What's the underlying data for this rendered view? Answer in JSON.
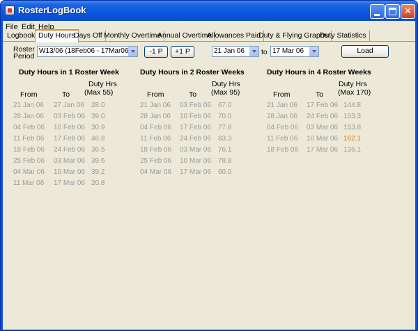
{
  "window": {
    "title": "RosterLogBook"
  },
  "menu": [
    "File",
    "Edit",
    "Help"
  ],
  "tabs": [
    "Logbook",
    "Duty Hours",
    "Days Off",
    "Monthly Overtime",
    "Annual Overtime",
    "Allowances Paid",
    "Duty & Flying Graphs",
    "Duty Statistics"
  ],
  "active_tab": "Duty Hours",
  "controls": {
    "roster_label_1": "Roster",
    "roster_label_2": "Period",
    "roster_period_value": "W13/06 (18Feb06 - 17Mar06)",
    "minus_button": "-1 P",
    "plus_button": "+1 P",
    "from_date": "21 Jan  06",
    "to_label": "to",
    "to_date": "17 Mar  06",
    "load_button": "Load"
  },
  "sections": [
    {
      "title": "Duty Hours in 1 Roster Week",
      "headers": {
        "from": "From",
        "to": "To",
        "duty_1": "Duty Hrs",
        "duty_2": "(Max 55)"
      },
      "rows": [
        [
          "21 Jan 06",
          "27 Jan 06",
          "28.0"
        ],
        [
          "28 Jan 06",
          "03 Feb 06",
          "39.0"
        ],
        [
          "04 Feb 06",
          "10 Feb 06",
          "30.9"
        ],
        [
          "11 Feb 06",
          "17 Feb 06",
          "46.8"
        ],
        [
          "18 Feb 06",
          "24 Feb 06",
          "36.5"
        ],
        [
          "25 Feb 06",
          "03 Mar 06",
          "39.6"
        ],
        [
          "04 Mar 06",
          "10 Mar 06",
          "39.2"
        ],
        [
          "11 Mar 06",
          "17 Mar 06",
          "20.8"
        ]
      ]
    },
    {
      "title": "Duty Hours in 2 Roster Weeks",
      "headers": {
        "from": "From",
        "to": "To",
        "duty_1": "Duty Hrs",
        "duty_2": "(Max 95)"
      },
      "rows": [
        [
          "21 Jan 06",
          "03 Feb 06",
          "67.0"
        ],
        [
          "28 Jan 06",
          "10 Feb 06",
          "70.0"
        ],
        [
          "04 Feb 06",
          "17 Feb 06",
          "77.8"
        ],
        [
          "11 Feb 06",
          "24 Feb 06",
          "83.3"
        ],
        [
          "18 Feb 06",
          "03 Mar 06",
          "76.1"
        ],
        [
          "25 Feb 06",
          "10 Mar 06",
          "78.8"
        ],
        [
          "04 Mar 06",
          "17 Mar 06",
          "60.0"
        ]
      ]
    },
    {
      "title": "Duty Hours in 4 Roster Weeks",
      "headers": {
        "from": "From",
        "to": "To",
        "duty_1": "Duty Hrs",
        "duty_2": "(Max 170)"
      },
      "rows": [
        [
          "21 Jan 06",
          "17 Feb 06",
          "144.8"
        ],
        [
          "28 Jan 06",
          "24 Feb 06",
          "153.3"
        ],
        [
          "04 Feb 06",
          "03 Mar 06",
          "153.8"
        ],
        [
          "11 Feb 06",
          "10 Mar 06",
          "162.1"
        ],
        [
          "18 Feb 06",
          "17 Mar 06",
          "136.1"
        ]
      ],
      "highlight_row": 3
    }
  ],
  "colors": {
    "muted_text": "#9a9a9a",
    "highlight": "#e07b10",
    "background": "#ece9d8"
  }
}
